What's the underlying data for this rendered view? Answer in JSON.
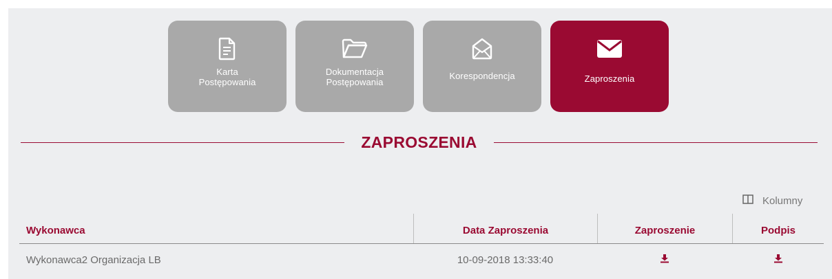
{
  "tabs": [
    {
      "line1": "Karta",
      "line2": "Postępowania",
      "icon": "document-icon",
      "active": false
    },
    {
      "line1": "Dokumentacja",
      "line2": "Postępowania",
      "icon": "folder-icon",
      "active": false
    },
    {
      "line1": "Korespondencja",
      "line2": "",
      "icon": "envelope-open-icon",
      "active": false
    },
    {
      "line1": "Zaproszenia",
      "line2": "",
      "icon": "envelope-icon",
      "active": true
    }
  ],
  "section": {
    "title": "ZAPROSZENIA"
  },
  "columns_button": {
    "label": "Kolumny",
    "icon": "columns-icon"
  },
  "table": {
    "headers": [
      "Wykonawca",
      "Data Zaproszenia",
      "Zaproszenie",
      "Podpis"
    ],
    "rows": [
      {
        "wykonawca": "Wykonawca2 Organizacja LB",
        "date": "10-09-2018 13:33:40",
        "zaproszenie_icon": "download-icon",
        "podpis_icon": "download-icon"
      }
    ]
  },
  "colors": {
    "accent": "#9a0a32",
    "tile_inactive": "#a9a9a9",
    "panel_bg": "#edeef0"
  }
}
